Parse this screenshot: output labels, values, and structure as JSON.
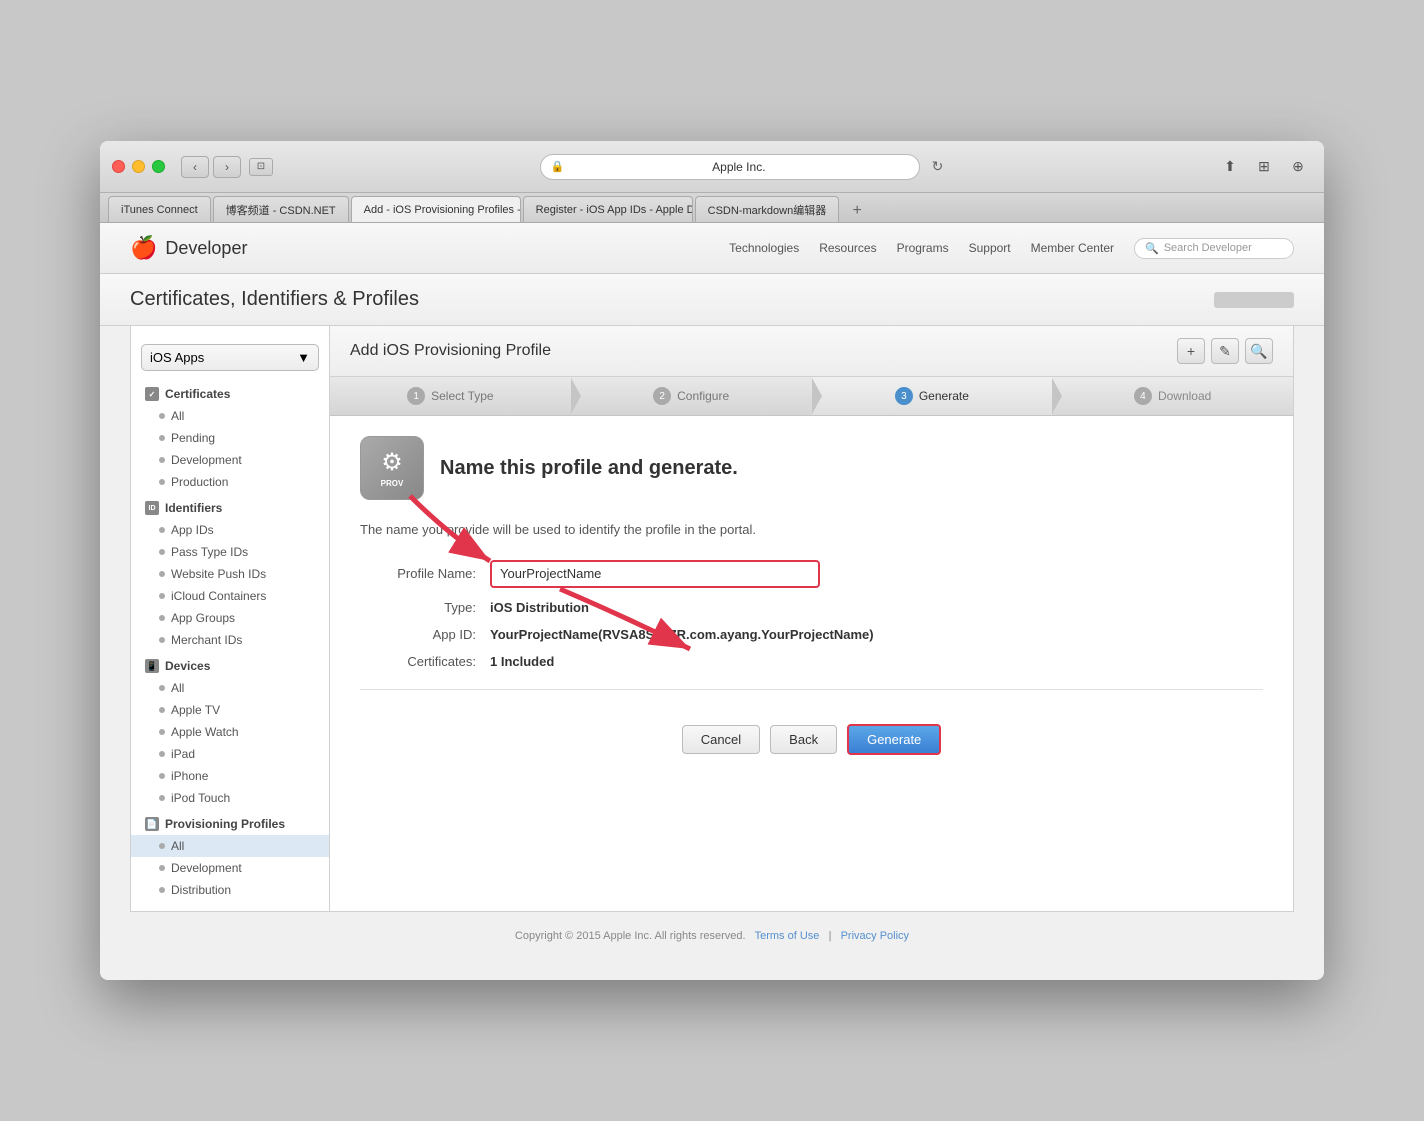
{
  "browser": {
    "url": "Apple Inc.",
    "tabs": [
      {
        "id": "itunes",
        "label": "iTunes Connect",
        "active": false
      },
      {
        "id": "csdn",
        "label": "博客频道 - CSDN.NET",
        "active": false
      },
      {
        "id": "provisioning",
        "label": "Add - iOS Provisioning Profiles - Appl...",
        "active": true
      },
      {
        "id": "register",
        "label": "Register - iOS App IDs - Apple Developer",
        "active": false
      },
      {
        "id": "markdown",
        "label": "CSDN-markdown编辑器",
        "active": false
      }
    ]
  },
  "header": {
    "logo": "🍎",
    "brand": "Developer",
    "nav": [
      "Technologies",
      "Resources",
      "Programs",
      "Support",
      "Member Center"
    ],
    "search_placeholder": "Search Developer"
  },
  "page_header": {
    "title": "Certificates, Identifiers & Profiles"
  },
  "sidebar": {
    "dropdown": "iOS Apps",
    "sections": [
      {
        "id": "certificates",
        "icon": "cert",
        "label": "Certificates",
        "items": [
          "All",
          "Pending",
          "Development",
          "Production"
        ]
      },
      {
        "id": "identifiers",
        "icon": "ID",
        "label": "Identifiers",
        "items": [
          "App IDs",
          "Pass Type IDs",
          "Website Push IDs",
          "iCloud Containers",
          "App Groups",
          "Merchant IDs"
        ]
      },
      {
        "id": "devices",
        "icon": "dev",
        "label": "Devices",
        "items": [
          "All",
          "Apple TV",
          "Apple Watch",
          "iPad",
          "iPhone",
          "iPod Touch"
        ]
      },
      {
        "id": "provisioning",
        "icon": "prov",
        "label": "Provisioning Profiles",
        "items": [
          "All",
          "Development",
          "Distribution"
        ]
      }
    ],
    "active_section": "Provisioning Profiles",
    "active_item": "All"
  },
  "content": {
    "title": "Add iOS Provisioning Profile",
    "steps": [
      {
        "label": "Select Type",
        "num": "1",
        "state": "completed"
      },
      {
        "label": "Configure",
        "num": "2",
        "state": "completed"
      },
      {
        "label": "Generate",
        "num": "3",
        "state": "active"
      },
      {
        "label": "Download",
        "num": "4",
        "state": "inactive"
      }
    ],
    "form": {
      "heading": "Name this profile and generate.",
      "description": "The name you provide will be used to identify the profile in the portal.",
      "fields": [
        {
          "label": "Profile Name:",
          "type": "input",
          "value": "YourProjectName"
        },
        {
          "label": "Type:",
          "type": "text",
          "value": "iOS Distribution"
        },
        {
          "label": "App ID:",
          "type": "text",
          "value": "YourProjectName(RVSA8S3F7R.com.ayang.YourProjectName)"
        },
        {
          "label": "Certificates:",
          "type": "text",
          "value": "1 Included"
        }
      ],
      "buttons": {
        "cancel": "Cancel",
        "back": "Back",
        "generate": "Generate"
      }
    }
  },
  "footer": {
    "copyright": "Copyright © 2015 Apple Inc. All rights reserved.",
    "terms": "Terms of Use",
    "separator": "|",
    "privacy": "Privacy Policy"
  }
}
